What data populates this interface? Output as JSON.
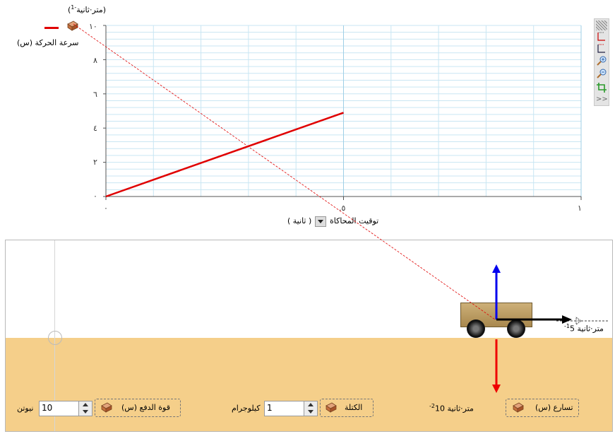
{
  "graph": {
    "y_unit": "(متر·ثانية-1)",
    "y_unit_main": "(متر·ثانية",
    "y_unit_sup": "-1",
    "y_unit_close": ")",
    "legend_label": "سرعة الحركة (س)",
    "y_ticks": [
      "٠",
      "٢",
      "٤",
      "٦",
      "٨",
      "١٠"
    ],
    "x_ticks": [
      "٠",
      ".٥",
      "١"
    ],
    "x_axis_label": "توقيت المحاكاة",
    "x_unit_select": "( ثانية )",
    "series_color": "#e00000"
  },
  "chart_data": {
    "type": "line",
    "series": [
      {
        "x": [
          0,
          0.5
        ],
        "y": [
          0,
          4.9
        ]
      }
    ],
    "xlim": [
      0,
      1
    ],
    "ylim": [
      0,
      10
    ],
    "x_ticks": [
      0,
      0.5,
      1
    ],
    "y_ticks": [
      0,
      2,
      4,
      6,
      8,
      10
    ],
    "xlabel": "توقيت المحاكاة ( ثانية )",
    "ylabel": "(متر·ثانية-1)",
    "legend": [
      "سرعة الحركة (س)"
    ],
    "grid": true
  },
  "toolbar": {
    "icons": [
      "pattern-icon",
      "red-bracket-icon",
      "blue-bracket-icon",
      "zoom-in-icon",
      "zoom-out-icon",
      "crop-icon",
      "more-icon"
    ],
    "more_label": ">>"
  },
  "simulation": {
    "velocity_label_num": "5",
    "velocity_label_unit": "متر·ثانية",
    "velocity_label_sup": "-1",
    "ground_color": "#f5cf8a"
  },
  "controls": {
    "force": {
      "label": "قوة الدفع (س)",
      "value": "10",
      "unit": "نيوتن"
    },
    "mass": {
      "label": "الكتلة",
      "value": "1",
      "unit": "كيلوجرام"
    },
    "acceleration": {
      "label": "تسارع (س)",
      "value_num": "10",
      "value_unit": "متر·ثانية",
      "value_sup": "-2"
    }
  }
}
